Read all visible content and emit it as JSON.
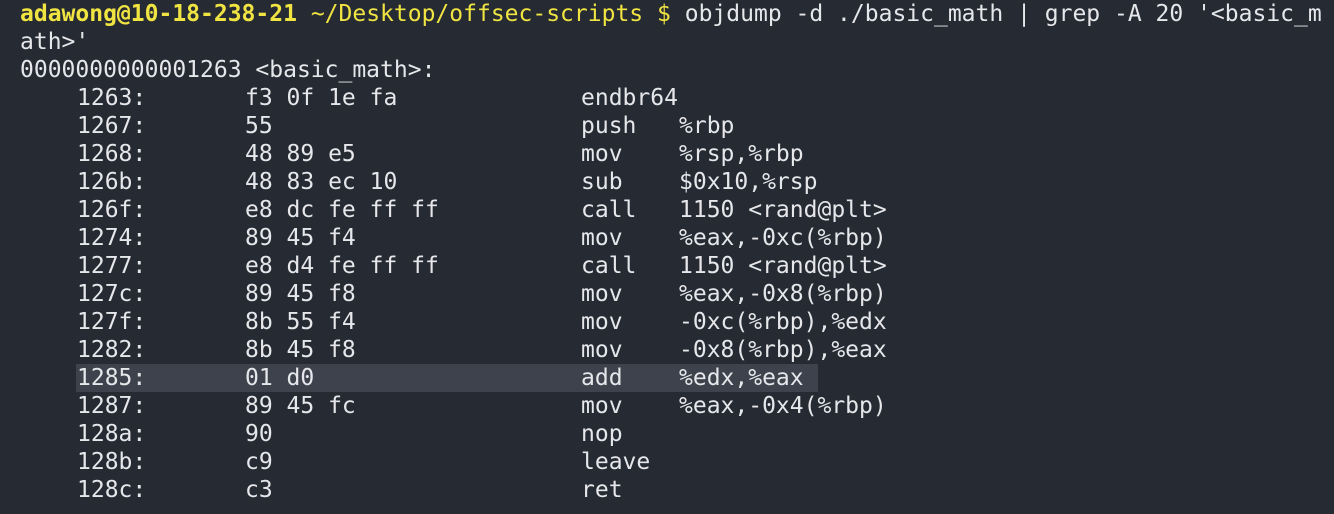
{
  "prompt": {
    "user_host": "adawong@10-18-238-21",
    "path": "~/Desktop/offsec-scripts",
    "symbol": "$",
    "command": "objdump -d ./basic_math | grep -A 20 '<basic_math>'"
  },
  "function_header": "0000000000001263 <basic_math>:",
  "rows": [
    {
      "addr": "1263:",
      "bytes": "f3 0f 1e fa",
      "mnemonic": "endbr64",
      "operands": ""
    },
    {
      "addr": "1267:",
      "bytes": "55",
      "mnemonic": "push",
      "operands": "%rbp"
    },
    {
      "addr": "1268:",
      "bytes": "48 89 e5",
      "mnemonic": "mov",
      "operands": "%rsp,%rbp"
    },
    {
      "addr": "126b:",
      "bytes": "48 83 ec 10",
      "mnemonic": "sub",
      "operands": "$0x10,%rsp"
    },
    {
      "addr": "126f:",
      "bytes": "e8 dc fe ff ff",
      "mnemonic": "call",
      "operands": "1150 <rand@plt>"
    },
    {
      "addr": "1274:",
      "bytes": "89 45 f4",
      "mnemonic": "mov",
      "operands": "%eax,-0xc(%rbp)"
    },
    {
      "addr": "1277:",
      "bytes": "e8 d4 fe ff ff",
      "mnemonic": "call",
      "operands": "1150 <rand@plt>"
    },
    {
      "addr": "127c:",
      "bytes": "89 45 f8",
      "mnemonic": "mov",
      "operands": "%eax,-0x8(%rbp)"
    },
    {
      "addr": "127f:",
      "bytes": "8b 55 f4",
      "mnemonic": "mov",
      "operands": "-0xc(%rbp),%edx"
    },
    {
      "addr": "1282:",
      "bytes": "8b 45 f8",
      "mnemonic": "mov",
      "operands": "-0x8(%rbp),%eax"
    },
    {
      "addr": "1285:",
      "bytes": "01 d0",
      "mnemonic": "add",
      "operands": "%edx,%eax",
      "selected": true
    },
    {
      "addr": "1287:",
      "bytes": "89 45 fc",
      "mnemonic": "mov",
      "operands": "%eax,-0x4(%rbp)"
    },
    {
      "addr": "128a:",
      "bytes": "90",
      "mnemonic": "nop",
      "operands": ""
    },
    {
      "addr": "128b:",
      "bytes": "c9",
      "mnemonic": "leave",
      "operands": ""
    },
    {
      "addr": "128c:",
      "bytes": "c3",
      "mnemonic": "ret",
      "operands": ""
    }
  ]
}
